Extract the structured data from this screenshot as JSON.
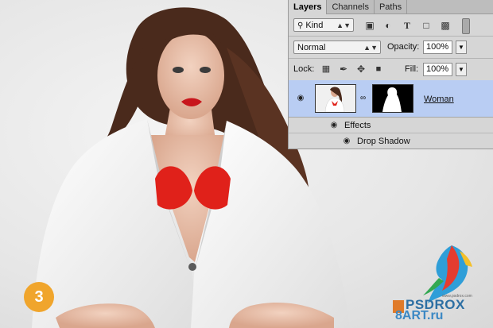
{
  "step_number": "3",
  "panel": {
    "tabs": [
      {
        "label": "Layers",
        "active": true
      },
      {
        "label": "Channels",
        "active": false
      },
      {
        "label": "Paths",
        "active": false
      }
    ],
    "filter": {
      "value": "Kind",
      "icons": [
        "image-filter-icon",
        "adjustment-filter-icon",
        "type-filter-icon",
        "shape-filter-icon",
        "smart-object-filter-icon",
        "filter-toggle-icon"
      ]
    },
    "blend_mode": "Normal",
    "opacity_label": "Opacity:",
    "opacity_value": "100%",
    "lock_label": "Lock:",
    "lock_icons": [
      "lock-transparent-icon",
      "lock-image-icon",
      "lock-position-icon",
      "lock-all-icon"
    ],
    "fill_label": "Fill:",
    "fill_value": "100%",
    "layer": {
      "name": "Woman",
      "selected": true
    },
    "effects_label": "Effects",
    "effect_item": "Drop Shadow"
  },
  "watermark": {
    "line1": "PSDROX",
    "line2": "8ART.ru",
    "small": "www.psdrox.com"
  },
  "colors": {
    "selected_layer": "#b9cdf3",
    "badge": "#f0a52c",
    "panel_bg": "#d6d6d6"
  }
}
